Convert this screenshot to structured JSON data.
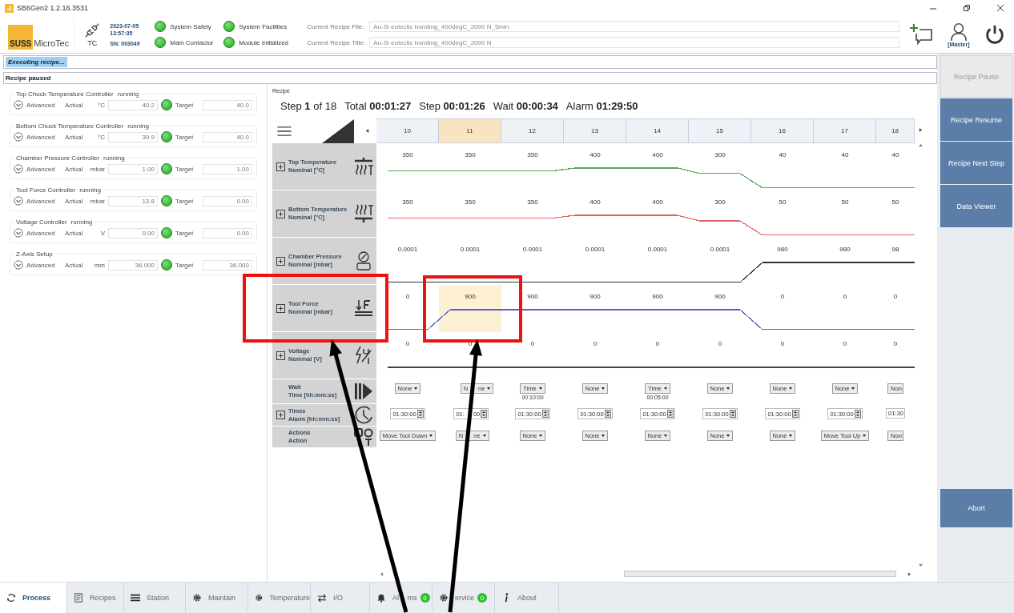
{
  "window": {
    "title": "SB6Gen2 1.2.16.3531"
  },
  "header": {
    "logo_mark": "SUSS",
    "logo_text": "MicroTec",
    "connection": "TC",
    "date": "2023-07-05",
    "time": "13:57:35",
    "serial": "SN: 003049",
    "indicators": [
      {
        "label": "System Safety",
        "on": true
      },
      {
        "label": "System Facilities",
        "on": true
      },
      {
        "label": "Main Contactor",
        "on": true
      },
      {
        "label": "Module Initialized",
        "on": true
      }
    ],
    "recipe_fields": [
      {
        "label": "Current Recipe File:",
        "value": "Au-Si eutectic bonding_400degC_2000 N_5min"
      },
      {
        "label": "Current Recipe Title:",
        "value": "Au-Si eutectic bonding_400degC_2000 N"
      }
    ],
    "user": "[Master]"
  },
  "status": {
    "executing": "Executing recipe...",
    "message": "Recipe paused"
  },
  "controllers": [
    {
      "title": "Top Chuck Temperature Controller",
      "status": "running",
      "advanced": "Advanced",
      "actual_label": "Actual",
      "unit": "°C",
      "actual": "40.2",
      "ok": true,
      "target_label": "Target",
      "target": "40.0"
    },
    {
      "title": "Bottom Chuck Temperature Controller",
      "status": "running",
      "advanced": "Advanced",
      "actual_label": "Actual",
      "unit": "°C",
      "actual": "39.9",
      "ok": true,
      "target_label": "Target",
      "target": "40.0"
    },
    {
      "title": "Chamber Pressure Controller",
      "status": "running",
      "advanced": "Advanced",
      "actual_label": "Actual",
      "unit": "mbar",
      "actual": "1.00",
      "ok": true,
      "target_label": "Target",
      "target": "1.00"
    },
    {
      "title": "Tool Force Controller",
      "status": "running",
      "advanced": "Advanced",
      "actual_label": "Actual",
      "unit": "mbar",
      "actual": "13.8",
      "ok": true,
      "target_label": "Target",
      "target": "0.00"
    },
    {
      "title": "Voltage Controller",
      "status": "running",
      "advanced": "Advanced",
      "actual_label": "Actual",
      "unit": "V",
      "actual": "0.00",
      "ok": true,
      "target_label": "Target",
      "target": "0.00"
    },
    {
      "title": "Z-Axis Setup",
      "advanced": "Advanced",
      "actual_label": "Actual",
      "unit": "mm",
      "actual": "36.000",
      "ok": true,
      "target_label": "Target",
      "target": "36.000"
    }
  ],
  "recipe": {
    "group_label": "Recipe",
    "summary": [
      "Step **1** of 18",
      "Total **00:01:27**",
      "Step **00:01:26**",
      "Wait **00:00:34**",
      "Alarm **01:29:50**"
    ],
    "steps": [
      {
        "label": "10",
        "selected": false,
        "partial": false
      },
      {
        "label": "11",
        "selected": true,
        "partial": false
      },
      {
        "label": "12",
        "selected": false,
        "partial": false
      },
      {
        "label": "13",
        "selected": false,
        "partial": false
      },
      {
        "label": "14",
        "selected": false,
        "partial": false
      },
      {
        "label": "15",
        "selected": false,
        "partial": false
      },
      {
        "label": "16",
        "selected": false,
        "partial": false
      },
      {
        "label": "17",
        "selected": false,
        "partial": false
      },
      {
        "label": "18",
        "selected": false,
        "partial": true
      }
    ],
    "rows": [
      {
        "kind": "values",
        "expandable": true,
        "name": "Top Temperature",
        "unit": "Nominal [°C]",
        "color": "#5aa55a",
        "cells": [
          {
            "text": "350",
            "selected": false
          },
          {
            "text": "350",
            "selected": false
          },
          {
            "text": "350",
            "selected": false
          },
          {
            "text": "400",
            "selected": false
          },
          {
            "text": "400",
            "selected": false
          },
          {
            "text": "300",
            "selected": false
          },
          {
            "text": "40",
            "selected": false
          },
          {
            "text": "40",
            "selected": false
          },
          {
            "text": "40",
            "selected": false
          }
        ]
      },
      {
        "kind": "values",
        "expandable": true,
        "name": "Bottom Temperature",
        "unit": "Nominal [°C]",
        "color": "#e06464",
        "cells": [
          {
            "text": "350",
            "selected": false
          },
          {
            "text": "350",
            "selected": false
          },
          {
            "text": "350",
            "selected": false
          },
          {
            "text": "400",
            "selected": false
          },
          {
            "text": "400",
            "selected": false
          },
          {
            "text": "300",
            "selected": false
          },
          {
            "text": "50",
            "selected": false
          },
          {
            "text": "50",
            "selected": false
          },
          {
            "text": "50",
            "selected": false
          }
        ]
      },
      {
        "kind": "values",
        "expandable": true,
        "name": "Chamber Pressure",
        "unit": "Nominal [mbar]",
        "color": "#333333",
        "cells": [
          {
            "text": "0.0001",
            "selected": false
          },
          {
            "text": "0.0001",
            "selected": false
          },
          {
            "text": "0.0001",
            "selected": false
          },
          {
            "text": "0.0001",
            "selected": false
          },
          {
            "text": "0.0001",
            "selected": false
          },
          {
            "text": "0.0001",
            "selected": false
          },
          {
            "text": "980",
            "selected": false
          },
          {
            "text": "980",
            "selected": false
          },
          {
            "text": "98",
            "selected": false
          }
        ]
      },
      {
        "kind": "values",
        "expandable": true,
        "name": "Tool Force",
        "unit": "Nominal [mbar]",
        "color": "#5a5ad2",
        "cells": [
          {
            "text": "0",
            "selected": false
          },
          {
            "text": "900",
            "selected": true
          },
          {
            "text": "900",
            "selected": false
          },
          {
            "text": "900",
            "selected": false
          },
          {
            "text": "900",
            "selected": false
          },
          {
            "text": "900",
            "selected": false
          },
          {
            "text": "0",
            "selected": false
          },
          {
            "text": "0",
            "selected": false
          },
          {
            "text": "0",
            "selected": false
          }
        ]
      },
      {
        "kind": "values",
        "expandable": true,
        "name": "Voltage",
        "unit": "Nominal [V]",
        "color": "#444444",
        "cells": [
          {
            "text": "0",
            "selected": false
          },
          {
            "text": "0",
            "selected": false
          },
          {
            "text": "0",
            "selected": false
          },
          {
            "text": "0",
            "selected": false
          },
          {
            "text": "0",
            "selected": false
          },
          {
            "text": "0",
            "selected": false
          },
          {
            "text": "0",
            "selected": false
          },
          {
            "text": "0",
            "selected": false
          },
          {
            "text": "0",
            "selected": false
          }
        ]
      },
      {
        "kind": "dropdown",
        "expandable": false,
        "name": "Wait",
        "unit": "Time [hh:mm:ss]",
        "cells": [
          {
            "text": "None"
          },
          {
            "parts": [
              "N",
              "ne"
            ]
          },
          {
            "text": "Time",
            "note": "00:10:00"
          },
          {
            "text": "None"
          },
          {
            "text": "Time",
            "note": "00:05:00"
          },
          {
            "text": "None"
          },
          {
            "text": "None"
          },
          {
            "text": "None"
          },
          {
            "text": "Non"
          }
        ]
      },
      {
        "kind": "spinner",
        "expandable": true,
        "name": "Times",
        "unit": "Alarm [hh:mm:ss]",
        "cells": [
          {
            "text": "01:30:00"
          },
          {
            "parts": [
              "01:",
              "00"
            ]
          },
          {
            "text": "01:30:00"
          },
          {
            "text": "01:30:00"
          },
          {
            "text": "01:30:00"
          },
          {
            "text": "01:30:00"
          },
          {
            "text": "01:30:00"
          },
          {
            "text": "01:30:00"
          },
          {
            "text": "01:30"
          }
        ]
      },
      {
        "kind": "dropdown",
        "expandable": false,
        "name": "Actions",
        "unit": "Action",
        "cells": [
          {
            "text": "Move Tool Down"
          },
          {
            "parts": [
              "N",
              "ne"
            ]
          },
          {
            "text": "None"
          },
          {
            "text": "None"
          },
          {
            "text": "None"
          },
          {
            "text": "None"
          },
          {
            "text": "None"
          },
          {
            "text": "Move Tool Up"
          },
          {
            "text": "Non"
          }
        ]
      }
    ]
  },
  "side_buttons": [
    {
      "label": "Recipe Pause",
      "disabled": true
    },
    {
      "label": "Recipe Resume",
      "disabled": false
    },
    {
      "label": "Recipe Next Step",
      "disabled": false
    },
    {
      "label": "Data Viewer",
      "disabled": false
    }
  ],
  "abort": {
    "label": "Abort",
    "disabled": false
  },
  "tabs": [
    {
      "label": "Process",
      "selected": true
    },
    {
      "label": "Recipes",
      "selected": false
    },
    {
      "label": "Station",
      "selected": false
    },
    {
      "label": "Maintain",
      "selected": false
    },
    {
      "label": "Temperature",
      "selected": false
    },
    {
      "label": "I/O",
      "selected": false
    },
    {
      "parts": [
        "Al",
        "ms"
      ],
      "selected": false,
      "badge": "0"
    },
    {
      "label": "ervice",
      "selected": false,
      "badge": "0"
    },
    {
      "label": "About",
      "selected": false
    }
  ]
}
